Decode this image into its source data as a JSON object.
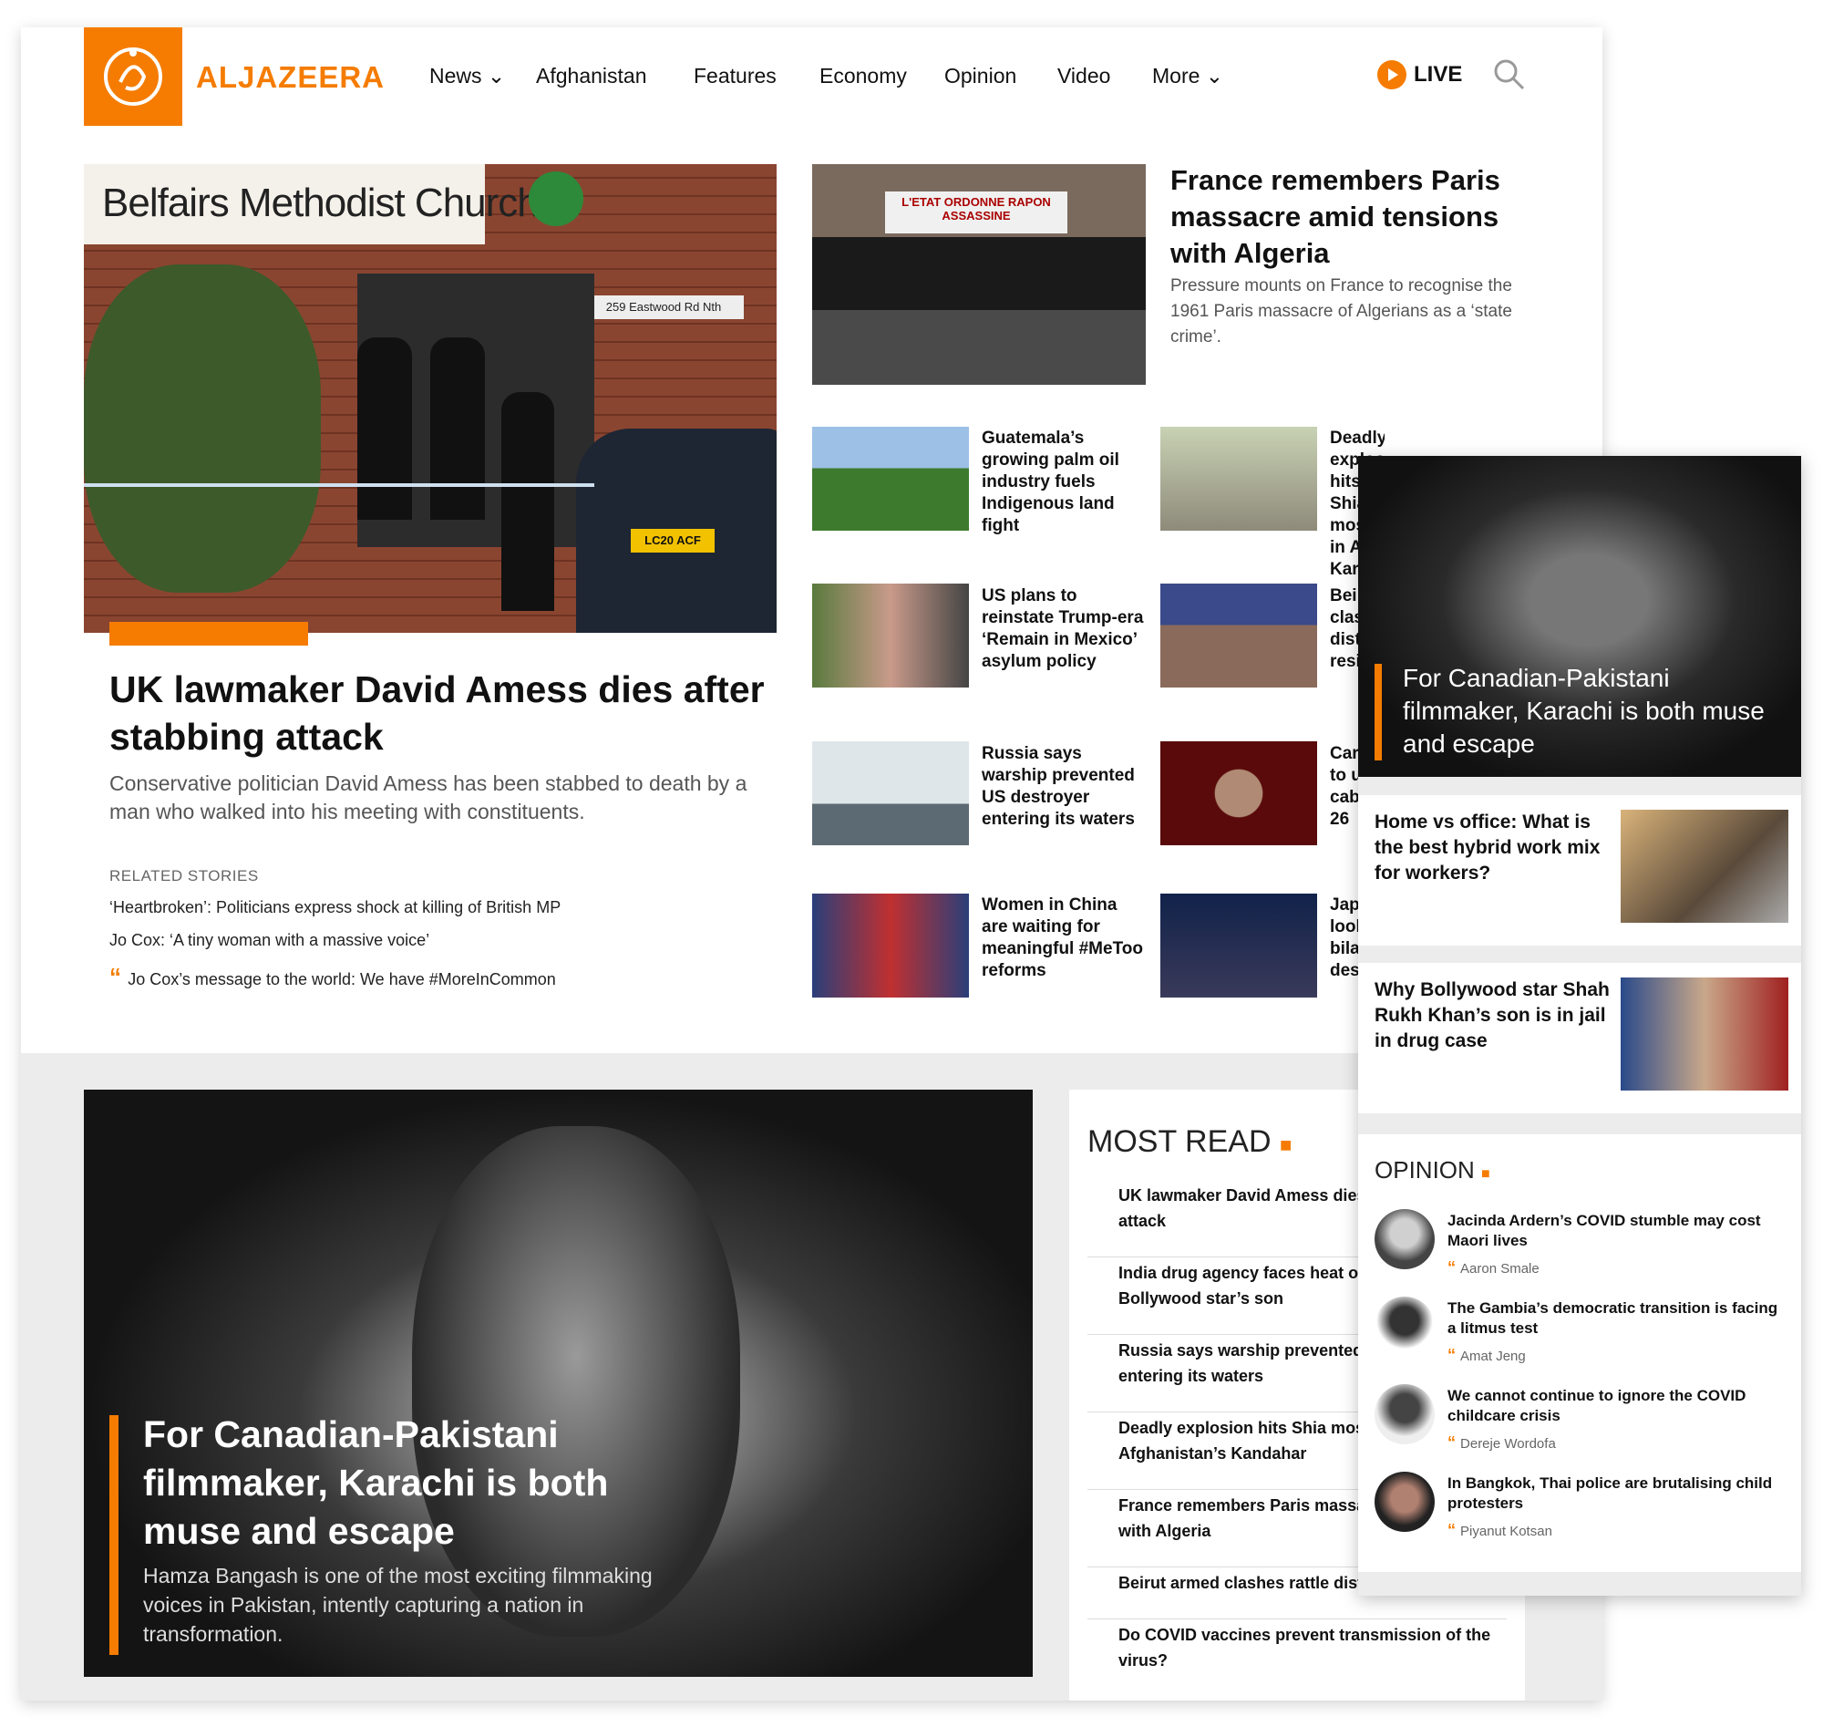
{
  "header": {
    "logo_text": "ALJAZEERA",
    "nav": [
      "News",
      "Afghanistan",
      "Features",
      "Economy",
      "Opinion",
      "Video",
      "More"
    ],
    "live_label": "LIVE"
  },
  "hero": {
    "title": "UK lawmaker David Amess dies after stabbing attack",
    "summary": "Conservative politician David Amess has been stabbed to death by a man who walked into his meeting with constituents.",
    "image_sign": "Belfairs Methodist Church",
    "image_street": "259 Eastwood Rd Nth",
    "image_plate": "LC20 ACF",
    "related_label": "RELATED STORIES",
    "related": [
      "‘Heartbroken’: Politicians express shock at killing of British MP",
      "Jo Cox: ‘A tiny woman with a massive voice’",
      "Jo Cox’s message to the world: We have #MoreInCommon"
    ]
  },
  "top_story": {
    "title": "France remembers Paris massacre amid tensions with Algeria",
    "summary": "Pressure mounts on France to recognise the 1961 Paris massacre of Algerians as a ‘state crime’.",
    "banner": "L'ETAT ORDONNE RAPON ASSASSINE"
  },
  "grid_left": [
    "Guatemala’s growing palm oil industry fuels Indigenous land fight",
    "US plans to reinstate Trump-era ‘Remain in Mexico’ asylum policy",
    "Russia says warship prevented US destroyer entering its waters",
    "Women in China are waiting for meaningful #MeToo reforms"
  ],
  "grid_right": [
    "Deadly explosion hits Shia mosque in Afg Kar",
    "Bei clas dist resi",
    "Car to u cab 26",
    "Jap lool bila des"
  ],
  "feature": {
    "title": "For Canadian-Pakistani filmmaker, Karachi is both muse and escape",
    "summary": "Hamza Bangash is one of the most exciting filmmaking voices in Pakistan, intently capturing a nation in transformation."
  },
  "most_read": {
    "heading": "MOST READ",
    "items": [
      "UK lawmaker David Amess dies after stabbing attack",
      "India drug agency faces heat over arrest of Bollywood star’s son",
      "Russia says warship prevented US destroyer entering its waters",
      "Deadly explosion hits Shia mosque in Afghanistan’s Kandahar",
      "France remembers Paris massacre amid tensions with Algeria",
      "Beirut armed clashes rattle district residents",
      "Do COVID vaccines prevent transmission of the virus?"
    ]
  },
  "mobile": {
    "feature_title": "For Canadian-Pakistani filmmaker, Karachi is both muse and escape",
    "cards": [
      "Home vs office: What is the best hybrid work mix for workers?",
      "Why Bollywood star Shah Rukh Khan’s son is in jail in drug case"
    ],
    "opinion_heading": "OPINION",
    "opinions": [
      {
        "title": "Jacinda Ardern’s COVID stumble may cost Maori lives",
        "author": "Aaron Smale"
      },
      {
        "title": "The Gambia’s democratic transition is facing a litmus test",
        "author": "Amat Jeng"
      },
      {
        "title": "We cannot continue to ignore the COVID childcare crisis",
        "author": "Dereje Wordofa"
      },
      {
        "title": "In Bangkok, Thai police are brutalising child protesters",
        "author": "Piyanut Kotsan"
      }
    ]
  }
}
